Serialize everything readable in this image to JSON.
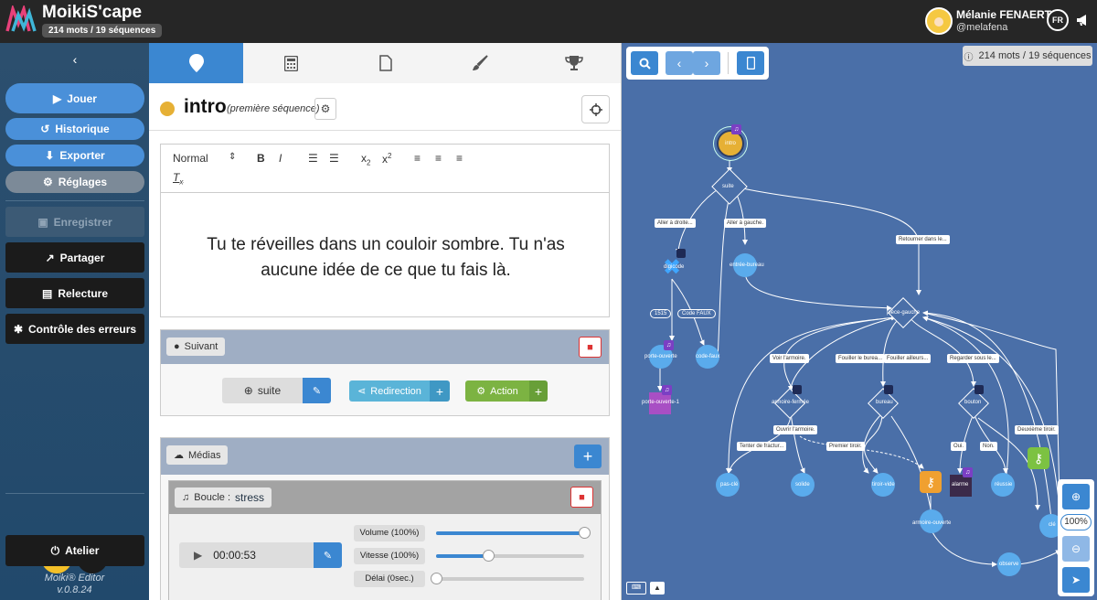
{
  "app": {
    "title": "MoikiS'cape",
    "word_count": "214 mots / 19 séquences"
  },
  "user": {
    "name": "Mélanie FENAERT",
    "handle": "@melafena",
    "lang": "FR"
  },
  "sidebar": {
    "play": "Jouer",
    "history": "Historique",
    "export": "Exporter",
    "settings": "Réglages",
    "save": "Enregistrer",
    "share": "Partager",
    "proofread": "Relecture",
    "errors": "Contrôle des erreurs",
    "workshop": "Atelier",
    "editor_name": "Moiki® Editor",
    "version": "v.0.8.24"
  },
  "sequence": {
    "name": "intro",
    "note": "(première séquence)"
  },
  "editor": {
    "format": "Normal",
    "text": "Tu te réveilles dans un couloir sombre. Tu n'as aucune idée de ce que tu fais là."
  },
  "next": {
    "label": "Suivant",
    "target": "suite",
    "redirect": "Redirection",
    "action": "Action"
  },
  "media": {
    "label": "Médias",
    "loop_label": "Boucle :",
    "loop_name": "stress",
    "time": "00:00:53",
    "volume": "Volume (100%)",
    "speed": "Vitesse (100%)",
    "delay": "Délai (0sec.)",
    "volume_level": 1.0,
    "speed_level": 0.35,
    "delay_level": 0.0
  },
  "graph": {
    "stats": "214 mots / 19 séquences",
    "zoom": "100%",
    "nodes": {
      "intro": "intro",
      "suite": "suite",
      "digicode": "digicode",
      "entree_bureau": "entrée-bureau",
      "porte_ouverte": "porte-ouverte",
      "code_faux": "code-faux",
      "porte_ouverte_1": "porte-ouverte-1",
      "piece_gauche": "pièce-gauche",
      "armoire_fermee": "armoire-fermée",
      "bureau": "bureau",
      "bouton": "bouton",
      "pas_cle": "pas-clé",
      "solide": "solide",
      "tiroir_vide": "tiroir-vide",
      "alarme": "alarme",
      "reussie": "réussie",
      "armoire_ouverte": "armoire-ouverte",
      "cle": "clé",
      "observe": "observe"
    },
    "labels": {
      "aller_droite": "Aller à droite...",
      "aller_gauche": "Aller à gauche.",
      "retourner": "Retourner dans le...",
      "code1515": "1515",
      "codefaux": "Code FAUX",
      "voir_armoire": "Voir l'armoire.",
      "fouiller_bureau": "Fouiller le burea...",
      "fouiller_ailleurs": "Fouiller ailleurs...",
      "regarder_sous": "Regarder sous le...",
      "ouvrir_armoire": "Ouvrir l'armoire.",
      "deuxieme_tiroir": "Deuxième tiroir.",
      "tenter_fracture": "Tenter de fractur...",
      "premier_tiroir": "Premier tiroir.",
      "oui": "Oui.",
      "non": "Non."
    }
  }
}
